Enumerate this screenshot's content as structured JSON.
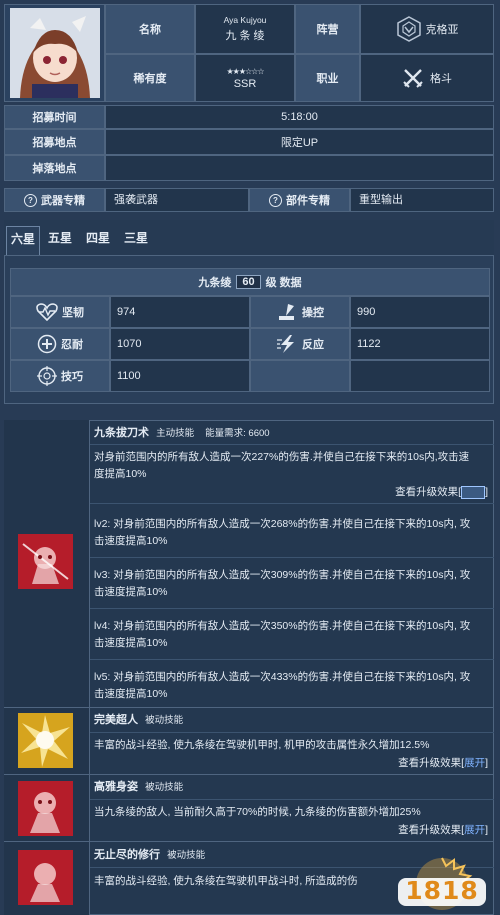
{
  "character": {
    "name_label": "名称",
    "name_roman": "Aya Kujyou",
    "name_cn": "九 条 绫",
    "faction_label": "阵营",
    "faction_value": "克格亚",
    "rarity_label": "稀有度",
    "rarity_stars": "★★★☆☆☆",
    "rarity_value": "SSR",
    "job_label": "职业",
    "job_value": "格斗"
  },
  "recruit": {
    "time_label": "招募时间",
    "time_value": "5:18:00",
    "place_label": "招募地点",
    "place_value": "限定UP",
    "drop_label": "掉落地点",
    "drop_value": ""
  },
  "exclusive": {
    "weapon_label": "武器专精",
    "weapon_value": "强袭武器",
    "part_label": "部件专精",
    "part_value": "重型输出"
  },
  "star_tabs": [
    "六星",
    "五星",
    "四星",
    "三星"
  ],
  "stats": {
    "title_prefix": "九条绫",
    "level": "60",
    "title_suffix": "级 数据",
    "rows": [
      {
        "label_a": "坚韧",
        "value_a": "974",
        "label_b": "操控",
        "value_b": "990"
      },
      {
        "label_a": "忍耐",
        "value_a": "1070",
        "label_b": "反应",
        "value_b": "1122"
      },
      {
        "label_a": "技巧",
        "value_a": "1100",
        "label_b": "",
        "value_b": ""
      }
    ]
  },
  "skills": {
    "more_text": "查看升级效果",
    "expand": "展开",
    "s1": {
      "name": "九条拔刀术",
      "type": "主动技能",
      "energy": "能量需求: 6600",
      "desc": "对身前范围内的所有敌人造成一次227%的伤害.并使自己在接下来的10s内,攻击速度提高10%",
      "levels": [
        "lv2: 对身前范围内的所有敌人造成一次268%的伤害.并使自己在接下来的10s内, 攻击速度提高10%",
        "lv3: 对身前范围内的所有敌人造成一次309%的伤害.并使自己在接下来的10s内, 攻击速度提高10%",
        "lv4: 对身前范围内的所有敌人造成一次350%的伤害.并使自己在接下来的10s内, 攻击速度提高10%",
        "lv5: 对身前范围内的所有敌人造成一次433%的伤害.并使自己在接下来的10s内, 攻击速度提高10%"
      ]
    },
    "s2": {
      "name": "完美超人",
      "type": "被动技能",
      "desc": "丰富的战斗经验, 使九条绫在驾驶机甲时, 机甲的攻击属性永久增加12.5%"
    },
    "s3": {
      "name": "高雅身姿",
      "type": "被动技能",
      "desc": "当九条绫的敌人, 当前耐久高于70%的时候, 九条绫的伤害额外增加25%"
    },
    "s4": {
      "name": "无止尽的修行",
      "type": "被动技能",
      "desc": "丰富的战斗经验, 使九条绫在驾驶机甲战斗时, 所造成的伤"
    }
  },
  "watermark": "1818"
}
